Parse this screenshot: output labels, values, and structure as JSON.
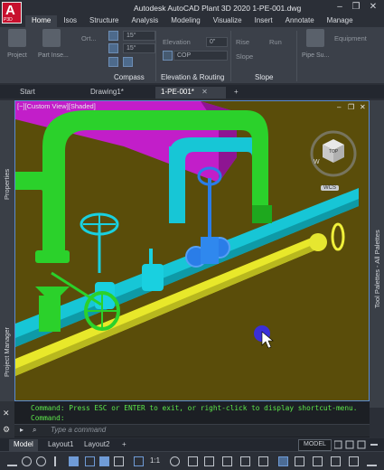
{
  "window": {
    "app_logo": "A",
    "app_logo_sub": "P3D",
    "title": "Autodesk AutoCAD Plant 3D 2020    1-PE-001.dwg",
    "controls": {
      "minimize": "–",
      "restore": "❐",
      "close": "✕"
    }
  },
  "ribbon_tabs": [
    "Home",
    "Isos",
    "Structure",
    "Analysis",
    "Modeling",
    "Visualize",
    "Insert",
    "Annotate",
    "Manage"
  ],
  "ribbon": {
    "project_label": "Project",
    "part_insert_label": "Part Inse...",
    "ortho_label": "Ort...",
    "angle_1": "15°",
    "angle_2": "15°",
    "compass_caption": "Compass",
    "elevation_label": "Elevation",
    "elevation_value": "0\"",
    "cop_label": "COP",
    "elevation_routing_caption": "Elevation & Routing",
    "rise_label": "Rise",
    "run_label": "Run",
    "slope_label": "Slope",
    "slope_caption": "Slope",
    "pipe_support_label": "Pipe Su...",
    "equipment_label": "Equipment"
  },
  "file_tabs": {
    "start": "Start",
    "drawing1": "Drawing1*",
    "active": "1-PE-001*",
    "close": "✕",
    "add": "+"
  },
  "palettes": {
    "properties": "Properties",
    "project_manager": "Project Manager",
    "tool_palettes": "Tool Palettes - All Palettes"
  },
  "viewport": {
    "label": "[−][Custom View][Shaded]",
    "controls": {
      "minimize": "–",
      "restore": "❐",
      "close": "✕"
    },
    "viewcube_face": "TOP",
    "viewcube_compass": "W",
    "wcs": "WCS"
  },
  "command": {
    "line1": "Command: Press ESC or ENTER to exit, or right-click to display shortcut-menu.",
    "line2": "Command:",
    "placeholder": "Type a command",
    "close": "✕"
  },
  "layout_tabs": [
    "Model",
    "Layout1",
    "Layout2"
  ],
  "layout_add": "+",
  "status": {
    "model": "MODEL",
    "scale": "1:1"
  },
  "colors": {
    "viewport_bg": "#5a4d0a",
    "pipe_cyan": "#17c6d6",
    "pipe_green": "#2bd12b",
    "pipe_yellow": "#e8e82a",
    "vessel_magenta": "#c21ec9",
    "valve_blue": "#2a7de8",
    "command_text": "#5de84a"
  }
}
